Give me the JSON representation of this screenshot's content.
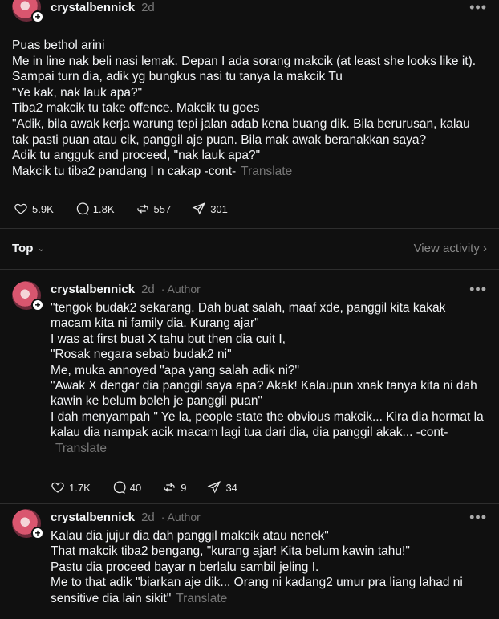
{
  "post": {
    "username": "crystalbennick",
    "time": "2d",
    "lines": [
      "Puas bethol arini",
      "Me in line nak beli nasi lemak. Depan I ada sorang makcik (at least she looks like it).",
      "Sampai turn dia, adik yg bungkus nasi tu tanya la makcik Tu",
      "\"Ye kak, nak lauk apa?\"",
      "Tiba2 makcik tu take offence. Makcik tu goes",
      "\"Adik, bila awak kerja warung tepi jalan adab kena buang dik. Bila berurusan, kalau tak pasti puan atau cik, panggil aje puan. Bila mak awak beranakkan saya?",
      "Adik tu angguk and proceed, \"nak lauk apa?\"",
      "Makcik tu tiba2 pandang I n cakap -cont-"
    ],
    "translate": "Translate",
    "likes": "5.9K",
    "comments": "1.8K",
    "reposts": "557",
    "shares": "301"
  },
  "sort": {
    "label": "Top",
    "view_activity": "View activity"
  },
  "replies": [
    {
      "username": "crystalbennick",
      "time": "2d",
      "author": "· Author",
      "lines": [
        "\"tengok budak2 sekarang. Dah buat salah, maaf xde, panggil kita kakak macam kita ni family dia. Kurang ajar\"",
        "I was at first buat X tahu but then dia cuit I,",
        "\"Rosak negara sebab budak2 ni\"",
        "Me, muka annoyed \"apa yang salah adik ni?\"",
        "\"Awak X dengar dia panggil saya apa? Akak! Kalaupun xnak tanya kita ni dah kawin ke belum boleh je panggil puan\"",
        "I dah menyampah \" Ye la, people state the obvious makcik... Kira dia hormat la kalau dia nampak acik macam lagi tua dari dia, dia panggil akak... -cont-"
      ],
      "translate": "Translate",
      "likes": "1.7K",
      "comments": "40",
      "reposts": "9",
      "shares": "34"
    },
    {
      "username": "crystalbennick",
      "time": "2d",
      "author": "· Author",
      "lines": [
        "Kalau dia jujur dia dah panggil makcik atau nenek\"",
        "That makcik tiba2 bengang, \"kurang ajar! Kita belum kawin tahu!\"",
        "Pastu dia proceed bayar n berlalu sambil jeling I.",
        "Me to that adik \"biarkan aje dik... Orang ni kadang2 umur pra liang lahad ni sensitive dia lain sikit\""
      ],
      "translate": "Translate"
    }
  ]
}
